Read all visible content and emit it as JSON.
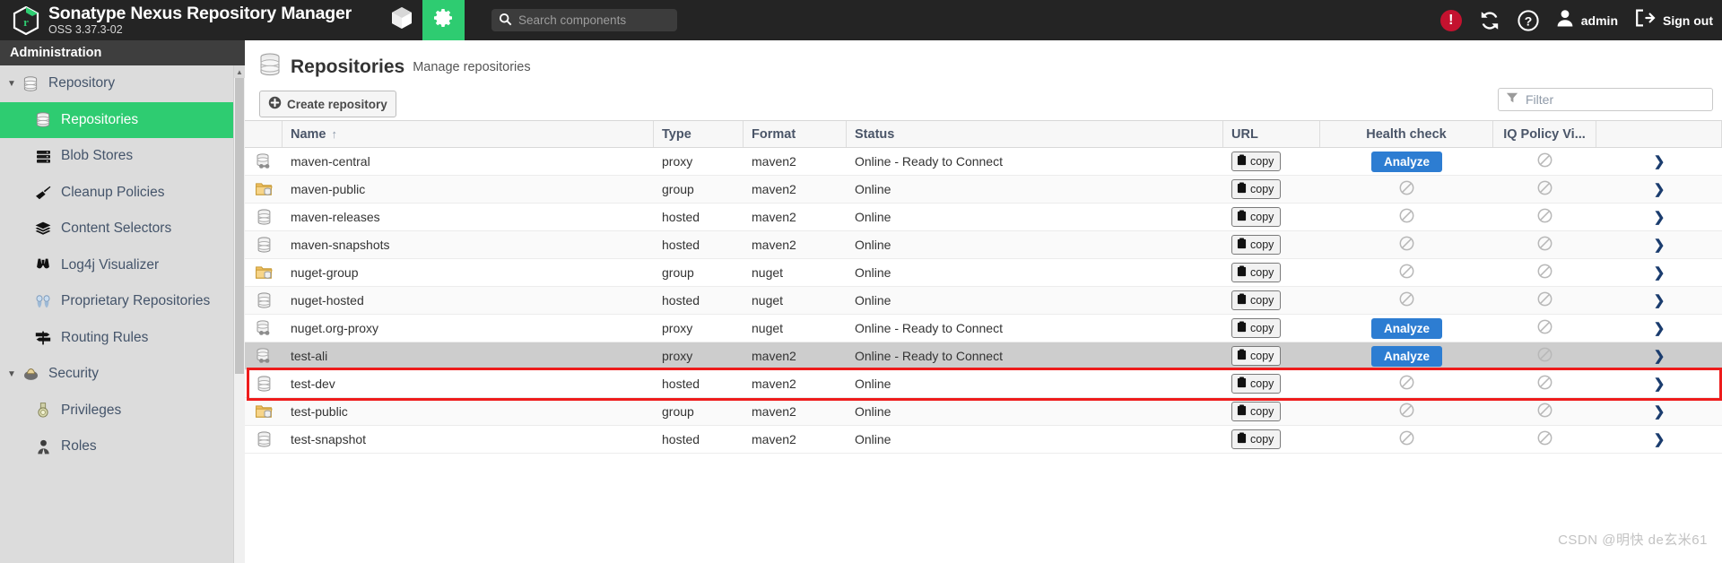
{
  "header": {
    "brand_title": "Sonatype Nexus Repository Manager",
    "brand_version": "OSS 3.37.3-02",
    "cube_icon": "cube-icon",
    "gear_icon": "gear-icon",
    "search": {
      "placeholder": "Search components",
      "value": "",
      "icon": "search-icon"
    },
    "alert_icon": "alert-exclamation-icon",
    "refresh_icon": "refresh-icon",
    "help_icon": "help-question-icon",
    "user_icon": "user-avatar-icon",
    "user_label": "admin",
    "signout_icon": "sign-out-icon",
    "signout_label": "Sign out",
    "accent_green": "#2ECC71",
    "alert_red": "#c4122f",
    "bg": "#242424"
  },
  "sidebar": {
    "section_title": "Administration",
    "items": [
      {
        "label": "Repository",
        "icon": "database-icon",
        "level": "group",
        "caret": "▼",
        "active": false
      },
      {
        "label": "Repositories",
        "icon": "database-icon",
        "level": "child",
        "caret": "",
        "active": true
      },
      {
        "label": "Blob Stores",
        "icon": "blob-stores-icon",
        "level": "child",
        "caret": "",
        "active": false
      },
      {
        "label": "Cleanup Policies",
        "icon": "broom-icon",
        "level": "child",
        "caret": "",
        "active": false
      },
      {
        "label": "Content Selectors",
        "icon": "layers-icon",
        "level": "child",
        "caret": "",
        "active": false
      },
      {
        "label": "Log4j Visualizer",
        "icon": "binoculars-icon",
        "level": "child",
        "caret": "",
        "active": false
      },
      {
        "label": "Proprietary Repositories",
        "icon": "proprietary-icon",
        "level": "child",
        "caret": "",
        "active": false
      },
      {
        "label": "Routing Rules",
        "icon": "signpost-icon",
        "level": "child",
        "caret": "",
        "active": false
      },
      {
        "label": "Security",
        "icon": "shield-icon",
        "level": "group",
        "caret": "▼",
        "active": false
      },
      {
        "label": "Privileges",
        "icon": "medal-icon",
        "level": "child",
        "caret": "",
        "active": false
      },
      {
        "label": "Roles",
        "icon": "roles-person-icon",
        "level": "child",
        "caret": "",
        "active": false
      }
    ],
    "active_bg": "#2ECC71",
    "bg": "#dcdcdc"
  },
  "main": {
    "page_icon": "database-icon",
    "page_title": "Repositories",
    "page_subtitle": "Manage repositories",
    "create_button": {
      "label": "Create repository",
      "icon": "plus-circle-icon"
    },
    "filter": {
      "placeholder": "Filter",
      "value": "",
      "icon": "funnel-icon"
    },
    "columns": [
      {
        "key": "icon",
        "label": ""
      },
      {
        "key": "name",
        "label": "Name",
        "sort": "↑"
      },
      {
        "key": "type",
        "label": "Type"
      },
      {
        "key": "format",
        "label": "Format"
      },
      {
        "key": "status",
        "label": "Status"
      },
      {
        "key": "url",
        "label": "URL"
      },
      {
        "key": "health",
        "label": "Health check"
      },
      {
        "key": "iq",
        "label": "IQ Policy Vi..."
      },
      {
        "key": "arrow",
        "label": ""
      }
    ],
    "copy_label": "copy",
    "copy_icon": "clipboard-icon",
    "analyze_label": "Analyze",
    "analyze_color": "#2D7DD2",
    "blocked_icon": "blocked-circle-icon",
    "row_arrow_icon": "chevron-right-icon",
    "rows": [
      {
        "icon": "proxy-repo-icon",
        "name": "maven-central",
        "type": "proxy",
        "format": "maven2",
        "status": "Online - Ready to Connect",
        "url": "copy",
        "health": "analyze",
        "iq": "blocked",
        "selected": false
      },
      {
        "icon": "group-repo-icon",
        "name": "maven-public",
        "type": "group",
        "format": "maven2",
        "status": "Online",
        "url": "copy",
        "health": "blocked",
        "iq": "blocked",
        "selected": false
      },
      {
        "icon": "hosted-repo-icon",
        "name": "maven-releases",
        "type": "hosted",
        "format": "maven2",
        "status": "Online",
        "url": "copy",
        "health": "blocked",
        "iq": "blocked",
        "selected": false
      },
      {
        "icon": "hosted-repo-icon",
        "name": "maven-snapshots",
        "type": "hosted",
        "format": "maven2",
        "status": "Online",
        "url": "copy",
        "health": "blocked",
        "iq": "blocked",
        "selected": false
      },
      {
        "icon": "group-repo-icon",
        "name": "nuget-group",
        "type": "group",
        "format": "nuget",
        "status": "Online",
        "url": "copy",
        "health": "blocked",
        "iq": "blocked",
        "selected": false
      },
      {
        "icon": "hosted-repo-icon",
        "name": "nuget-hosted",
        "type": "hosted",
        "format": "nuget",
        "status": "Online",
        "url": "copy",
        "health": "blocked",
        "iq": "blocked",
        "selected": false
      },
      {
        "icon": "proxy-repo-icon",
        "name": "nuget.org-proxy",
        "type": "proxy",
        "format": "nuget",
        "status": "Online - Ready to Connect",
        "url": "copy",
        "health": "analyze",
        "iq": "blocked",
        "selected": false
      },
      {
        "icon": "proxy-repo-icon",
        "name": "test-ali",
        "type": "proxy",
        "format": "maven2",
        "status": "Online - Ready to Connect",
        "url": "copy",
        "health": "analyze",
        "iq": "blocked",
        "selected": true
      },
      {
        "icon": "hosted-repo-icon",
        "name": "test-dev",
        "type": "hosted",
        "format": "maven2",
        "status": "Online",
        "url": "copy",
        "health": "blocked",
        "iq": "blocked",
        "selected": false
      },
      {
        "icon": "group-repo-icon",
        "name": "test-public",
        "type": "group",
        "format": "maven2",
        "status": "Online",
        "url": "copy",
        "health": "blocked",
        "iq": "blocked",
        "selected": false
      },
      {
        "icon": "hosted-repo-icon",
        "name": "test-snapshot",
        "type": "hosted",
        "format": "maven2",
        "status": "Online",
        "url": "copy",
        "health": "blocked",
        "iq": "blocked",
        "selected": false
      }
    ],
    "highlight_color": "#ee1c1c",
    "watermark": "CSDN @明快 de玄米61"
  }
}
